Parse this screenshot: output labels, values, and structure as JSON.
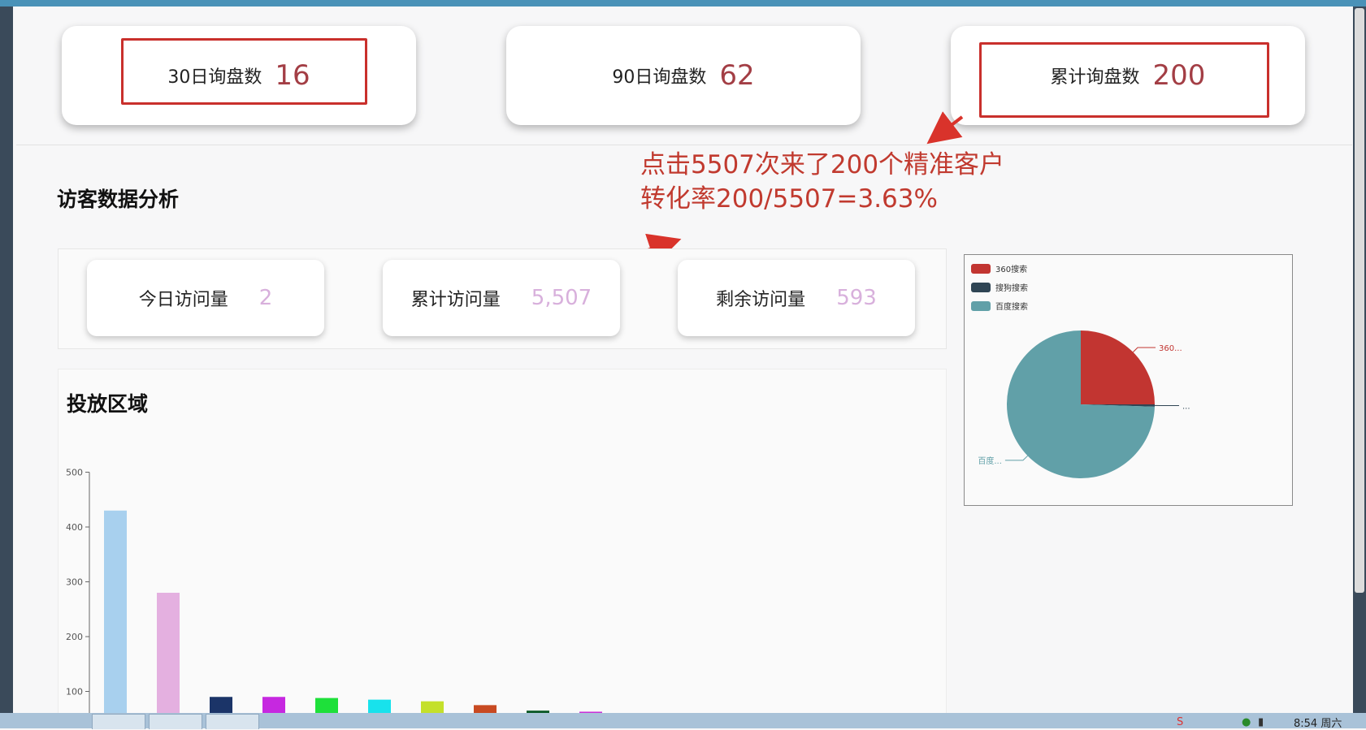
{
  "inquiry_stats": [
    {
      "label": "30日询盘数",
      "value": "16"
    },
    {
      "label": "90日询盘数",
      "value": "62"
    },
    {
      "label": "累计询盘数",
      "value": "200"
    }
  ],
  "annotation": {
    "line1": "点击5507次来了200个精准客户",
    "line2": "转化率200/5507=3.63%"
  },
  "visitor_section": {
    "title": "访客数据分析",
    "cards": [
      {
        "label": "今日访问量",
        "value": "2"
      },
      {
        "label": "累计访问量",
        "value": "5,507"
      },
      {
        "label": "剩余访问量",
        "value": "593"
      }
    ]
  },
  "region_section": {
    "title": "投放区域"
  },
  "chart_data": [
    {
      "type": "bar",
      "title": "投放区域",
      "yticks": [
        "100",
        "200",
        "300",
        "400",
        "500"
      ],
      "ylim": [
        0,
        500
      ],
      "values": [
        430,
        280,
        90,
        90,
        88,
        85,
        82,
        75,
        65,
        63
      ],
      "colors": [
        "#a8d0ee",
        "#e4b0e0",
        "#1b3468",
        "#c628e0",
        "#1ee03a",
        "#18e2ec",
        "#c4e02a",
        "#c84a22",
        "#0c5a28",
        "#c830d8"
      ]
    },
    {
      "type": "pie",
      "legend": [
        "360搜索",
        "搜狗搜索",
        "百度搜索"
      ],
      "legend_position": "top-left",
      "slice_labels": [
        "360...",
        "...",
        "百度..."
      ],
      "values": [
        25,
        0.5,
        74.5
      ],
      "colors": [
        "#c23531",
        "#2f4554",
        "#61a0a8"
      ]
    }
  ],
  "taskbar": {
    "clock": "8:54 周六"
  }
}
